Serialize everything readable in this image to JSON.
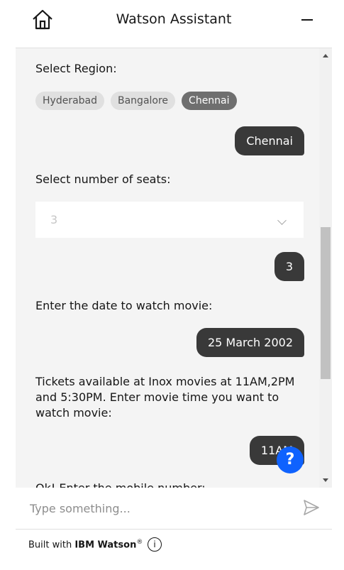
{
  "header": {
    "title": "Watson Assistant",
    "home_icon": "home-icon",
    "minimize_icon": "minimize-icon"
  },
  "conversation": {
    "region_prompt": "Select Region:",
    "region_options": [
      "Hyderabad",
      "Bangalore",
      "Chennai"
    ],
    "region_selected": "Chennai",
    "region_reply": "Chennai",
    "seats_prompt": "Select number of seats:",
    "seats_dropdown_value": "3",
    "seats_reply": "3",
    "date_prompt": "Enter the date to watch movie:",
    "date_reply": "25 March 2002",
    "tickets_prompt": "Tickets available at Inox movies at 11AM,2PM and 5:30PM. Enter movie time you want to watch movie:",
    "time_reply": "11AM",
    "mobile_prompt": "Ok! Enter the mobile number:"
  },
  "help_button": {
    "label": "?"
  },
  "input": {
    "placeholder": "Type something..."
  },
  "footer": {
    "prefix": "Built with ",
    "brand": "IBM Watson",
    "mark": "®",
    "info_icon": "i"
  },
  "colors": {
    "accent": "#0f62fe",
    "bubble": "#393939",
    "panel": "#f4f4f4"
  }
}
